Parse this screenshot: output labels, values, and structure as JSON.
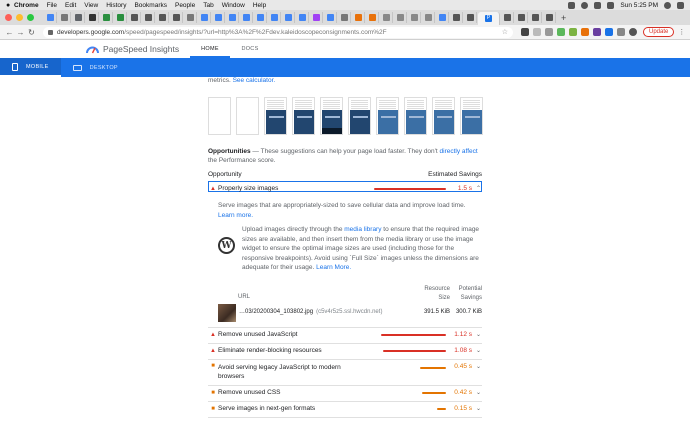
{
  "menubar": {
    "app": "Chrome",
    "items": [
      "File",
      "Edit",
      "View",
      "History",
      "Bookmarks",
      "People",
      "Tab",
      "Window",
      "Help"
    ],
    "clock": "Sun 5:25 PM"
  },
  "tabs": {
    "active_label": "P"
  },
  "toolbar": {
    "url_host": "developers.google.com",
    "url_path": "/speed/pagespeed/insights/?url=http%3A%2F%2Fdev.kaleidoscopeconsignments.com%2F",
    "update_label": "Update"
  },
  "header": {
    "title": "PageSpeed Insights",
    "nav": [
      "HOME",
      "DOCS"
    ]
  },
  "device": {
    "mobile": "MOBILE",
    "desktop": "DESKTOP"
  },
  "content": {
    "metrics_prefix": "metrics.",
    "metrics_link": "See calculator.",
    "opportunities_title": "Opportunities",
    "opportunities_text": "— These suggestions can help your page load faster. They don't",
    "opportunities_link": "directly affect",
    "opportunities_tail": "the Performance score.",
    "col_opportunity": "Opportunity",
    "col_savings": "Estimated Savings",
    "expanded": {
      "label": "Properly size images",
      "value": "1.5 s",
      "description": "Serve images that are appropriately-sized to save cellular data and improve load time.",
      "learn_more": "Learn more.",
      "wp_text_1": "Upload images directly through the",
      "wp_link": "media library",
      "wp_text_2": "to ensure that the required image sizes are available, and then insert them from the media library or use the image widget to ensure the optimal image sizes are used (including those for the responsive breakpoints). Avoid using `Full Size` images unless the dimensions are adequate for their usage.",
      "wp_learn_more": "Learn More.",
      "table": {
        "col_url": "URL",
        "col_size_1": "Resource",
        "col_size_2": "Size",
        "col_sav_1": "Potential",
        "col_sav_2": "Savings",
        "row": {
          "file": "…03/20200304_103802.jpg",
          "host": "(c5v4r5z5.ssl.hwcdn.net)",
          "size": "391.5 KiB",
          "savings": "300.7 KiB"
        }
      }
    },
    "audits": [
      {
        "label": "Remove unused JavaScript",
        "value": "1.12 s",
        "level": "red",
        "bar": 0.9
      },
      {
        "label": "Eliminate render-blocking resources",
        "value": "1.08 s",
        "level": "red",
        "bar": 0.87
      },
      {
        "label": "Avoid serving legacy JavaScript to modern",
        "label2": "browsers",
        "value": "0.45 s",
        "level": "orange",
        "bar": 0.36
      },
      {
        "label": "Remove unused CSS",
        "value": "0.42 s",
        "level": "orange",
        "bar": 0.34
      },
      {
        "label": "Serve images in next-gen formats",
        "value": "0.15 s",
        "level": "orange",
        "bar": 0.12
      }
    ],
    "expanded_bar": 1.0
  },
  "colors": {
    "accent": "#1a73e8",
    "fail": "#d93025",
    "average": "#e37400"
  }
}
